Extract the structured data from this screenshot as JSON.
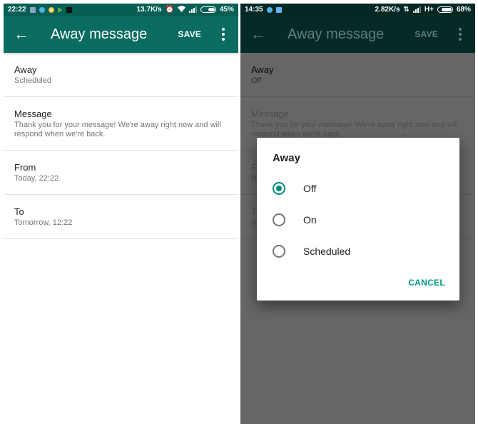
{
  "left_screen": {
    "statusbar": {
      "time": "22:22",
      "notification_icons": [
        "gallery-icon",
        "chat-bubble-icon",
        "chrome-icon",
        "play-store-icon",
        "app-icon"
      ],
      "net_speed": "13.7K/s",
      "status_icons": [
        "alarm-icon",
        "wifi-icon",
        "signal-icon"
      ],
      "battery": "45%"
    },
    "toolbar": {
      "title": "Away message",
      "save_label": "SAVE",
      "back_icon": "arrow-back-icon",
      "more_icon": "more-vert-icon"
    },
    "settings": [
      {
        "label": "Away",
        "value": "Scheduled"
      },
      {
        "label": "Message",
        "value": "Thank you for your message! We're away right now and will respond when we're back."
      },
      {
        "label": "From",
        "value": "Today, 22:22"
      },
      {
        "label": "To",
        "value": "Tomorrow, 12:22"
      }
    ]
  },
  "right_screen": {
    "statusbar": {
      "time": "14:35",
      "notification_icons": [
        "chat-bubble-icon",
        "message-icon"
      ],
      "net_speed": "2.82K/s",
      "status_icons": [
        "data-transfer-icon",
        "signal-icon"
      ],
      "network_type": "H+",
      "battery": "68%"
    },
    "toolbar": {
      "title": "Away message",
      "save_label": "SAVE"
    },
    "settings": [
      {
        "label": "Away",
        "value": "Off"
      },
      {
        "label": "Message",
        "value": "Thank you for your message! We're away right now and will respond when we're back."
      },
      {
        "label": "F",
        "value": "N"
      },
      {
        "label": "T",
        "value": "N"
      }
    ],
    "dialog": {
      "title": "Away",
      "options": [
        {
          "label": "Off",
          "selected": true
        },
        {
          "label": "On",
          "selected": false
        },
        {
          "label": "Scheduled",
          "selected": false
        }
      ],
      "cancel_label": "CANCEL"
    }
  },
  "colors": {
    "primary_dark": "#075e54",
    "primary": "#0a6b60",
    "accent": "#00897b"
  }
}
